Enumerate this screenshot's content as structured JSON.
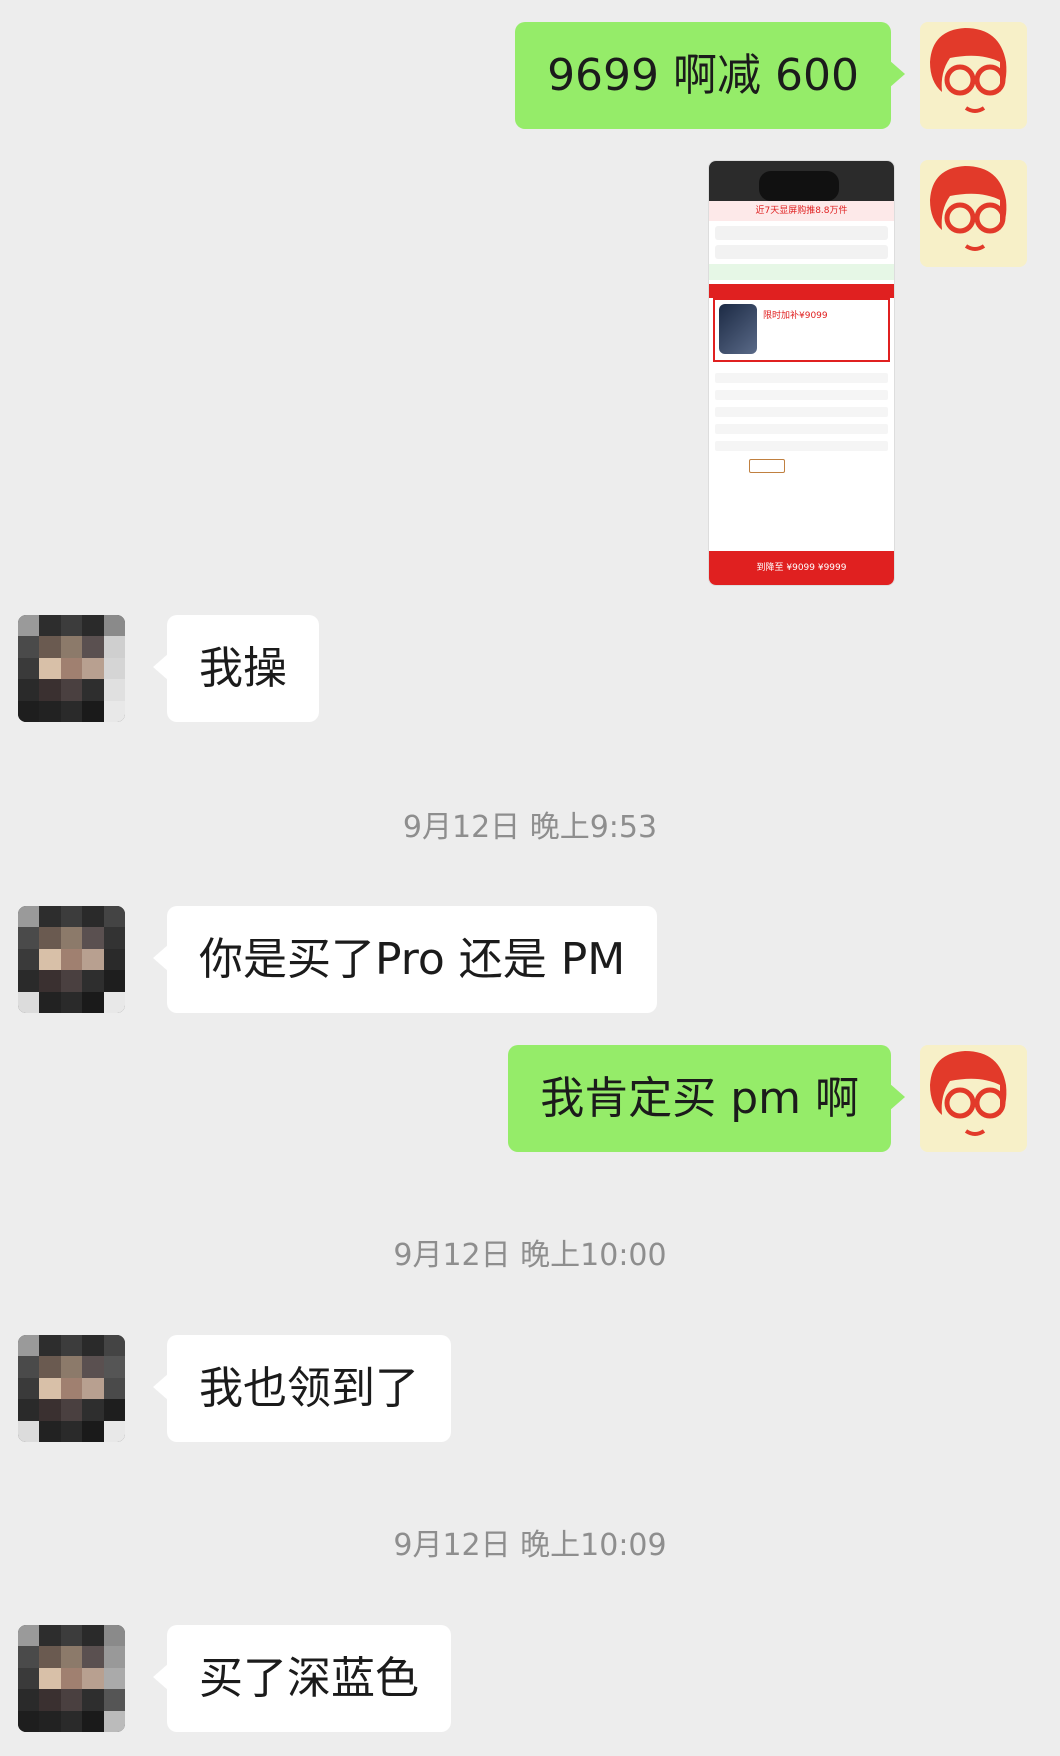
{
  "messages": {
    "m1": "9699 啊减 600",
    "m2_shot": {
      "banner": "近7天显屏购推8.8万件",
      "price": "限时加补¥9099",
      "bottom": "到降至 ¥9099 ¥9999"
    },
    "m3": "我操",
    "ts1": "9月12日 晚上9:53",
    "m4": "你是买了Pro  还是 PM",
    "m5": "我肯定买 pm 啊",
    "ts2": "9月12日 晚上10:00",
    "m6": "我也领到了",
    "ts3": "9月12日 晚上10:09",
    "m7": "买了深蓝色"
  },
  "colors": {
    "background": "#ededed",
    "self_bubble": "#95ec69",
    "other_bubble": "#ffffff",
    "timestamp": "#8e8e8e",
    "accent_red": "#e02020"
  },
  "icons": {
    "self_avatar": "red-hair-girl-glasses-avatar",
    "other_avatar": "pixelated-avatar"
  }
}
